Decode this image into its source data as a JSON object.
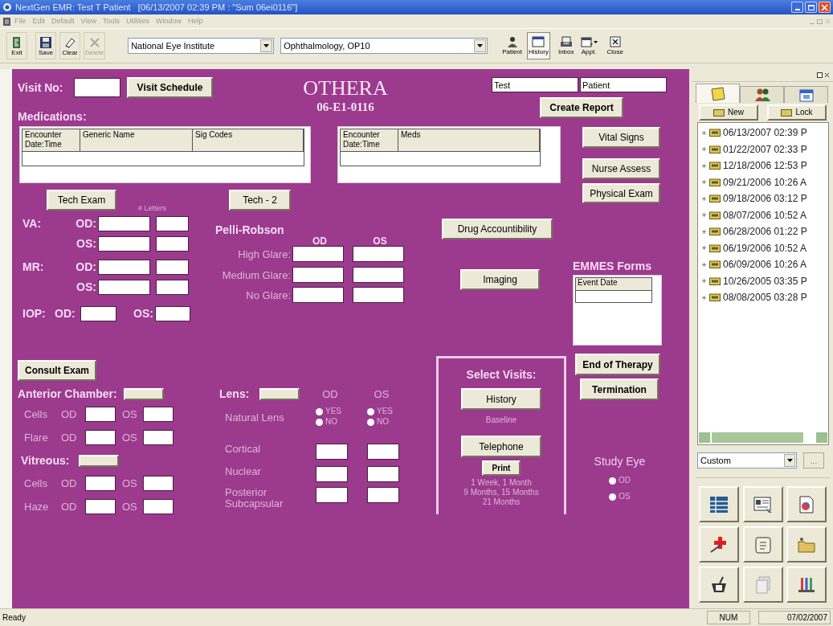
{
  "window": {
    "title": "NextGen EMR: Test T Patient   [06/13/2007 02:39 PM : \"Sum 06ei0116\"]"
  },
  "menu": [
    "File",
    "Edit",
    "Default",
    "View",
    "Tools",
    "Utilities",
    "Window",
    "Help"
  ],
  "toolbar": {
    "left_buttons": [
      {
        "label": "Exit",
        "disabled": false
      },
      {
        "label": "Save",
        "disabled": false
      },
      {
        "label": "Clear",
        "disabled": false
      },
      {
        "label": "Delete",
        "disabled": true
      }
    ],
    "dropdowns": [
      "National Eye Institute",
      "Ophthalmology, OP10"
    ],
    "right_buttons": [
      {
        "label": "Patient",
        "selected": false,
        "dropdown": false
      },
      {
        "label": "History",
        "selected": true,
        "dropdown": false
      },
      {
        "label": "Inbox",
        "selected": false,
        "dropdown": false
      },
      {
        "label": "Appt.",
        "selected": false,
        "dropdown": true
      },
      {
        "label": "Close",
        "selected": false,
        "dropdown": false
      }
    ]
  },
  "form": {
    "visit_no_label": "Visit No:",
    "visit_schedule_button": "Visit Schedule",
    "title": "OTHERA",
    "subtitle": "06-E1-0116",
    "patient_first": "Test",
    "patient_last": "Patient",
    "create_report_button": "Create Report",
    "medications": {
      "label": "Medications:",
      "columns": [
        "Encounter Date:Time",
        "Generic Name",
        "Sig Codes"
      ]
    },
    "meds_table": {
      "columns": [
        "Encounter Date:Time",
        "Meds"
      ]
    },
    "side_buttons": [
      "Vital Signs",
      "Nurse Assess",
      "Physical Exam"
    ],
    "tech_exam_button": "Tech Exam",
    "letters_label": "# Letters",
    "tech2_button": "Tech - 2",
    "va": {
      "label": "VA:",
      "rows": [
        "OD:",
        "OS:"
      ]
    },
    "mr": {
      "label": "MR:",
      "rows": [
        "OD:",
        "OS:"
      ]
    },
    "iop": {
      "label": "IOP:",
      "od": "OD:",
      "os": "OS:"
    },
    "pelli_robson": {
      "title": "Pelli-Robson",
      "columns": [
        "OD",
        "OS"
      ],
      "rows": [
        "High Glare:",
        "Medium Glare:",
        "No Glare:"
      ]
    },
    "drug_button": "Drug Accountibility",
    "imaging_button": "Imaging",
    "emmes": {
      "title": "EMMES Forms",
      "column": "Event Date"
    },
    "end_buttons": [
      "End of Therapy",
      "Termination"
    ],
    "select_visits": {
      "title": "Select Visits:",
      "history_button": "History",
      "baseline": "Baseline",
      "telephone_button": "Telephone",
      "print_button": "Print",
      "schedule_lines": [
        "1 Week, 1 Month",
        "9 Months, 15 Months",
        "21 Months"
      ]
    },
    "study_eye": {
      "title": "Study Eye",
      "options": [
        {
          "label": "OD",
          "selected": false
        },
        {
          "label": "OS",
          "selected": false
        }
      ]
    },
    "consult_button": "Consult Exam",
    "anterior_chamber": {
      "label": "Anterior Chamber:",
      "rows": [
        {
          "label": "Cells",
          "od": "OD",
          "os": "OS"
        },
        {
          "label": "Flare",
          "od": "OD",
          "os": "OS"
        }
      ]
    },
    "vitreous": {
      "label": "Vitreous:",
      "rows": [
        {
          "label": "Cells",
          "od": "OD",
          "os": "OS"
        },
        {
          "label": "Haze",
          "od": "OD",
          "os": "OS"
        }
      ]
    },
    "lens": {
      "label": "Lens:",
      "columns": [
        "OD",
        "OS"
      ],
      "natural_lens": {
        "label": "Natural Lens",
        "eyes": [
          {
            "options": [
              {
                "label": "YES",
                "selected": false
              },
              {
                "label": "NO",
                "selected": false
              }
            ]
          },
          {
            "options": [
              {
                "label": "YES",
                "selected": false
              },
              {
                "label": "NO",
                "selected": false
              }
            ]
          }
        ]
      },
      "rows": [
        "Cortical",
        "Nuclear",
        "Posterior Subcapsular"
      ]
    }
  },
  "panel": {
    "tabs": [
      {
        "selected": true
      },
      {
        "selected": false
      },
      {
        "selected": false
      }
    ],
    "buttons": [
      "New",
      "Lock"
    ],
    "encounters": [
      {
        "label": "06/13/2007 02:39 P",
        "expanded": false
      },
      {
        "label": "01/22/2007 02:33 P",
        "expanded": false
      },
      {
        "label": "12/18/2006 12:53 P",
        "expanded": false
      },
      {
        "label": "09/21/2006 10:26 A",
        "expanded": false
      },
      {
        "label": "09/18/2006 03:12 P",
        "expanded": false
      },
      {
        "label": "08/07/2006 10:52 A",
        "expanded": false
      },
      {
        "label": "06/28/2006 01:22 P",
        "expanded": false
      },
      {
        "label": "06/19/2006 10:52 A",
        "expanded": false
      },
      {
        "label": "06/09/2006 10:26 A",
        "expanded": false
      },
      {
        "label": "10/26/2005 03:35 P",
        "expanded": false
      },
      {
        "label": "08/08/2005 03:28 P",
        "expanded": false
      }
    ],
    "filter": "Custom",
    "more_button": "..."
  },
  "status_bar": {
    "message": "Ready",
    "num": "NUM",
    "date": "07/02/2007"
  }
}
